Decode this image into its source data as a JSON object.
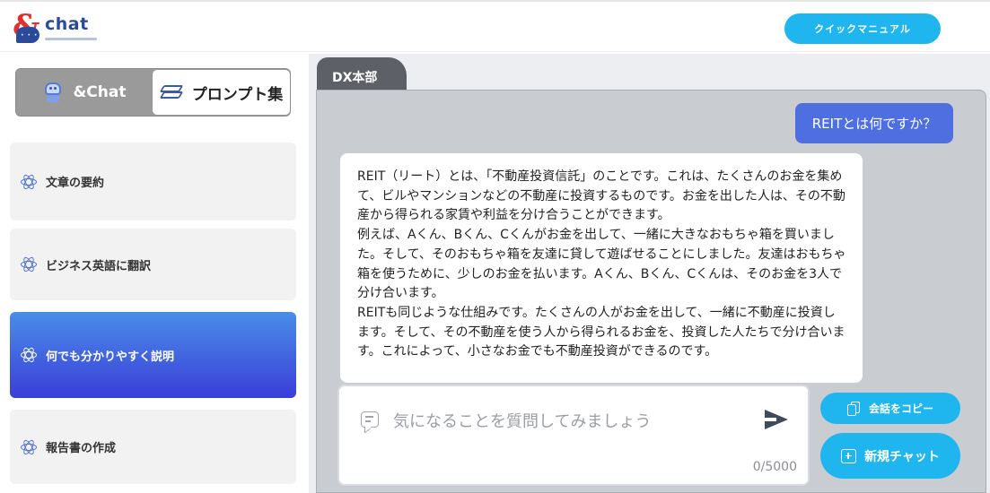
{
  "header": {
    "logo_text": "chat",
    "logo_mark": "&",
    "manual_button": "クイックマニュアル"
  },
  "sidebar": {
    "mode_toggle": {
      "chat_label": "&Chat",
      "prompt_label": "プロンプト集",
      "chat_icon": "robot-icon",
      "prompt_icon": "layers-icon"
    },
    "items": [
      {
        "label": "文章の要約",
        "icon": "atom-icon",
        "active": false
      },
      {
        "label": "ビジネス英語に翻訳",
        "icon": "atom-icon",
        "active": false
      },
      {
        "label": "何でも分かりやすく説明",
        "icon": "atom-icon",
        "active": true
      },
      {
        "label": "報告書の作成",
        "icon": "atom-icon",
        "active": false
      }
    ]
  },
  "main": {
    "tab_label": "DX本部",
    "messages": [
      {
        "role": "user",
        "text": "REITとは何ですか？"
      },
      {
        "role": "assistant",
        "text": "REIT（リート）とは、「不動産投資信託」のことです。これは、たくさんのお金を集めて、ビルやマンションなどの不動産に投資するものです。お金を出した人は、その不動産から得られる家賃や利益を分け合うことができます。\n例えば、Aくん、Bくん、Cくんがお金を出して、一緒に大きなおもちゃ箱を買いました。そして、そのおもちゃ箱を友達に貸して遊ばせることにしました。友達はおもちゃ箱を使うために、少しのお金を払います。Aくん、Bくん、Cくんは、そのお金を3人で分け合います。\nREITも同じような仕組みです。たくさんの人がお金を出して、一緒に不動産に投資します。そして、その不動産を使う人から得られるお金を、投資した人たちで分け合います。これによって、小さなお金でも不動産投資ができるのです。"
      }
    ],
    "input": {
      "placeholder": "気になることを質問してみましょう",
      "value": "",
      "counter": "0/5000"
    },
    "copy_button": "会話をコピー",
    "new_chat_button": "新規チャット"
  },
  "colors": {
    "accent": "#1fb6f0",
    "user_bubble": "#4f6fe0",
    "active_item_top": "#4a8ee8",
    "active_item_bottom": "#3a3ed9",
    "tab": "#5d6066"
  }
}
